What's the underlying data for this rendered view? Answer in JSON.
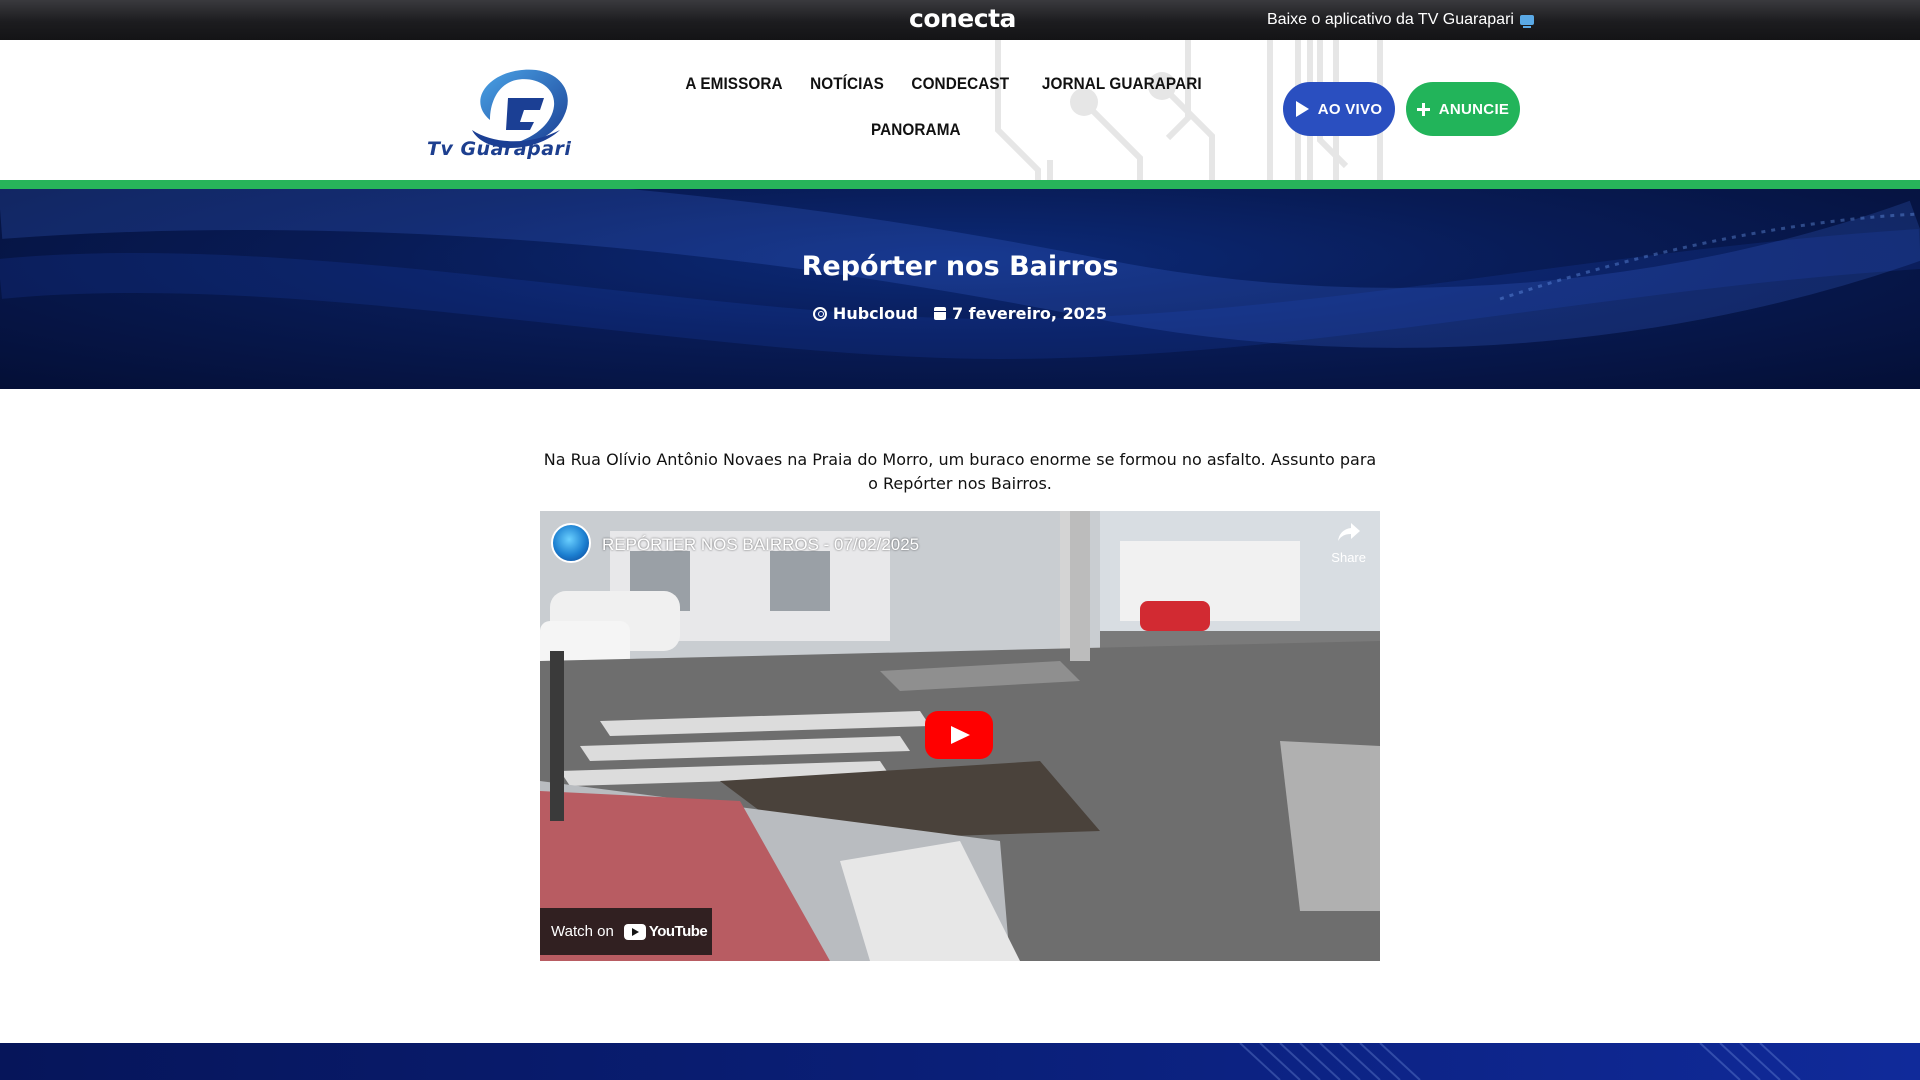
{
  "topbar": {
    "brand": "conecta",
    "app_link": "Baixe o aplicativo da TV Guarapari",
    "app_icon": "tv-icon"
  },
  "header": {
    "logo_text": "Tv Guarapari",
    "nav": [
      "A EMISSORA",
      "NOTÍCIAS",
      "CONDECAST",
      "JORNAL GUARAPARI",
      "PANORAMA"
    ],
    "live_button": "AO VIVO",
    "ads_button": "ANUNCIE",
    "colors": {
      "live": "#2a4fc0",
      "ads": "#22b45a",
      "stripe": "#27b45a"
    }
  },
  "hero": {
    "title": "Repórter nos Bairros",
    "author": "Hubcloud",
    "date": "7 fevereiro, 2025"
  },
  "article": {
    "text": "Na Rua Olívio Antônio Novaes na Praia do Morro, um buraco enorme se formou no asfalto. Assunto para o Repórter nos Bairros."
  },
  "video": {
    "title": "REPÓRTER NOS BAIRROS - 07/02/2025",
    "share_label": "Share",
    "watch_on": "Watch on",
    "youtube": "YouTube"
  }
}
